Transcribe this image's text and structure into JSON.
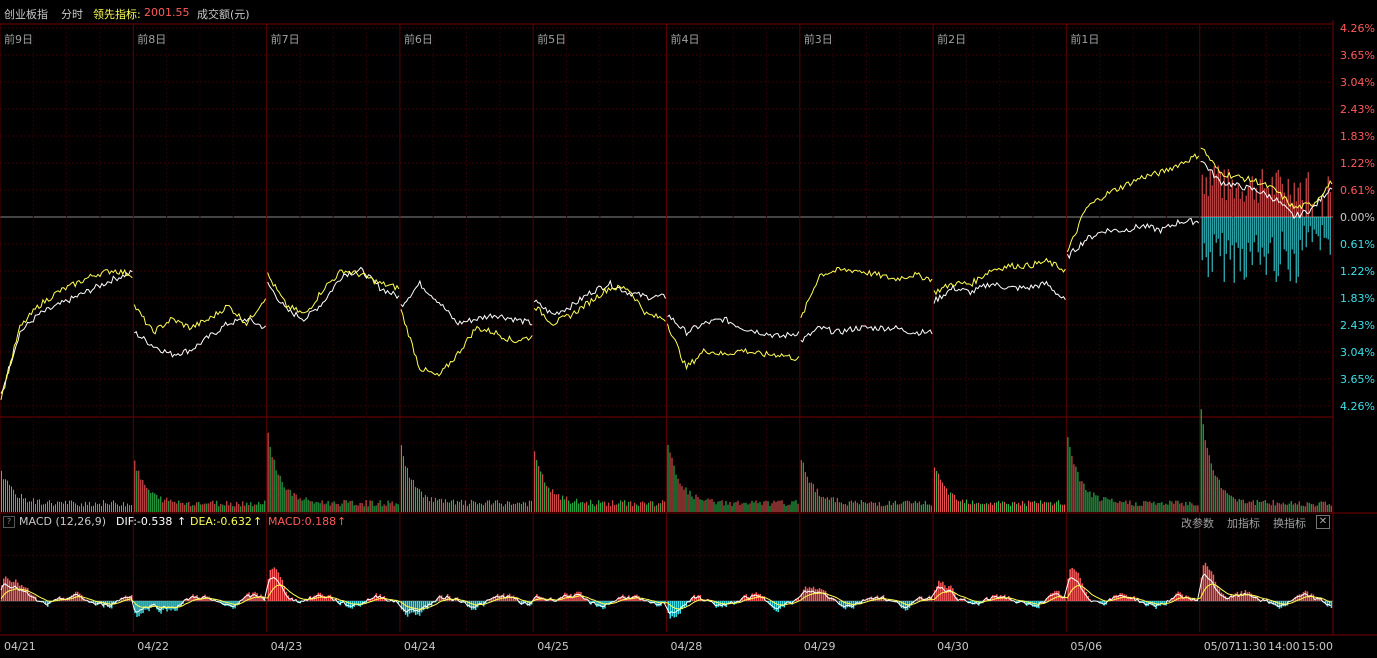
{
  "header": {
    "index_name": "创业板指",
    "mode": "分时",
    "leading_label": "领先指标:",
    "leading_value": "2001.55",
    "volume_label": "成交额(元)"
  },
  "macd_header": {
    "name": "MACD (12,26,9)",
    "dif": "DIF:-0.538",
    "dea": "DEA:-0.632",
    "macd": "MACD:0.188",
    "arrow": "↑"
  },
  "buttons": {
    "modify_params": "改参数",
    "add_indicator": "加指标",
    "switch_indicator": "换指标",
    "close": "✕"
  },
  "help": "?",
  "colors": {
    "up": "#ff5a5a",
    "down": "#3ce0e8",
    "yellow": "#ffff55",
    "white": "#ffffff",
    "grid": "#3a0000",
    "green": "#33cc55"
  },
  "chart_data": {
    "type": "line",
    "day_labels": [
      "前9日",
      "前8日",
      "前7日",
      "前6日",
      "前5日",
      "前4日",
      "前3日",
      "前2日",
      "前1日",
      ""
    ],
    "x_dates": [
      "04/21",
      "04/22",
      "04/23",
      "04/24",
      "04/25",
      "04/28",
      "04/29",
      "04/30",
      "05/06",
      "05/07"
    ],
    "x_times": [
      "11:30",
      "14:00",
      "15:00"
    ],
    "y_ticks": [
      "4.26%",
      "3.65%",
      "3.04%",
      "2.43%",
      "1.83%",
      "1.22%",
      "0.61%",
      "0.00%",
      "0.61%",
      "1.22%",
      "1.83%",
      "2.43%",
      "3.04%",
      "3.65%",
      "4.26%"
    ],
    "y_tick_signs": [
      "up",
      "up",
      "up",
      "up",
      "up",
      "up",
      "up",
      "zero",
      "down",
      "down",
      "down",
      "down",
      "down",
      "down",
      "down"
    ],
    "ylim": [
      -4.26,
      4.26
    ],
    "series": [
      {
        "color": "white",
        "values": [
          [
            -4.0,
            -2.6,
            -2.2,
            -2.0,
            -1.8,
            -1.6,
            -1.4,
            -1.25
          ],
          [
            -2.6,
            -2.9,
            -3.1,
            -3.0,
            -2.7,
            -2.4,
            -2.3,
            -2.5
          ],
          [
            -1.5,
            -2.1,
            -2.3,
            -1.9,
            -1.3,
            -1.2,
            -1.6,
            -1.8
          ],
          [
            -2.0,
            -1.5,
            -1.9,
            -2.4,
            -2.3,
            -2.2,
            -2.3,
            -2.4
          ],
          [
            -1.9,
            -2.2,
            -2.0,
            -1.7,
            -1.5,
            -1.7,
            -1.8,
            -1.8
          ],
          [
            -2.2,
            -2.6,
            -2.4,
            -2.3,
            -2.5,
            -2.6,
            -2.7,
            -2.6
          ],
          [
            -2.8,
            -2.5,
            -2.6,
            -2.5,
            -2.5,
            -2.5,
            -2.6,
            -2.6
          ],
          [
            -1.9,
            -1.6,
            -1.7,
            -1.5,
            -1.6,
            -1.6,
            -1.5,
            -1.9
          ],
          [
            -0.9,
            -0.5,
            -0.3,
            -0.3,
            -0.2,
            -0.3,
            -0.1,
            -0.1
          ],
          [
            1.3,
            0.8,
            0.7,
            0.6,
            0.4,
            0.0,
            0.2,
            0.7
          ]
        ]
      },
      {
        "color": "yellow",
        "values": [
          [
            -4.1,
            -2.5,
            -2.0,
            -1.7,
            -1.5,
            -1.3,
            -1.2,
            -1.3
          ],
          [
            -2.0,
            -2.6,
            -2.3,
            -2.5,
            -2.3,
            -2.0,
            -2.4,
            -1.8
          ],
          [
            -1.3,
            -2.0,
            -2.2,
            -1.6,
            -1.2,
            -1.3,
            -1.5,
            -1.6
          ],
          [
            -2.1,
            -3.4,
            -3.6,
            -3.1,
            -2.5,
            -2.6,
            -2.8,
            -2.7
          ],
          [
            -2.0,
            -2.4,
            -2.2,
            -1.9,
            -1.6,
            -1.6,
            -2.2,
            -2.3
          ],
          [
            -2.4,
            -3.4,
            -3.0,
            -3.1,
            -3.0,
            -3.1,
            -3.1,
            -3.2
          ],
          [
            -2.3,
            -1.3,
            -1.2,
            -1.2,
            -1.3,
            -1.4,
            -1.3,
            -1.4
          ],
          [
            -1.7,
            -1.5,
            -1.5,
            -1.2,
            -1.1,
            -1.1,
            -1.0,
            -1.2
          ],
          [
            -0.8,
            0.2,
            0.5,
            0.7,
            0.9,
            1.0,
            1.2,
            1.4
          ],
          [
            1.6,
            1.0,
            0.9,
            0.8,
            0.6,
            0.2,
            0.3,
            0.8
          ]
        ]
      }
    ],
    "bars_today": {
      "up_max": 1.4,
      "down_max": -1.5
    },
    "volume_spikes": [
      0.35,
      0.45,
      0.75,
      0.6,
      0.55,
      0.65,
      0.5,
      0.4,
      0.72,
      1.0
    ],
    "macd_spikes": [
      0.6,
      -0.5,
      0.8,
      -0.3,
      0.3,
      -0.3,
      0.3,
      0.4,
      0.7,
      1.0
    ]
  }
}
